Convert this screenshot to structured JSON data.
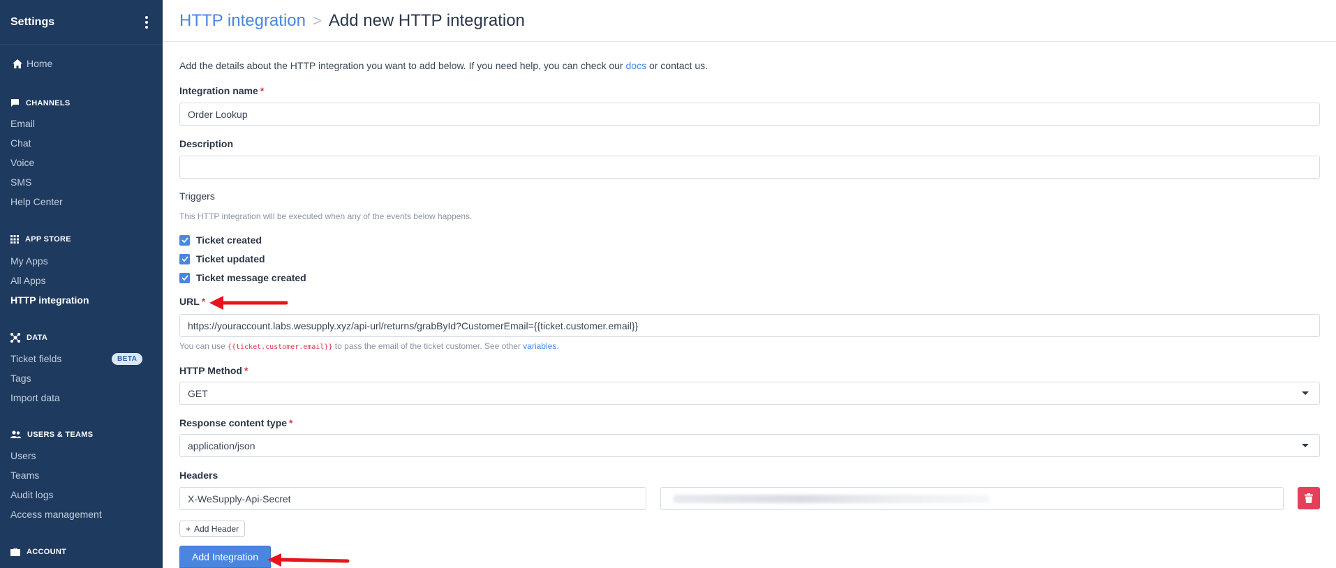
{
  "sidebar": {
    "title": "Settings",
    "home": "Home",
    "sections": {
      "channels": "CHANNELS",
      "app_store": "APP STORE",
      "data": "DATA",
      "users_teams": "USERS & TEAMS",
      "account": "ACCOUNT"
    },
    "channels": [
      "Email",
      "Chat",
      "Voice",
      "SMS",
      "Help Center"
    ],
    "app_store": [
      "My Apps",
      "All Apps",
      "HTTP integration"
    ],
    "data": [
      "Ticket fields",
      "Tags",
      "Import data"
    ],
    "data_badge": "BETA",
    "users_teams": [
      "Users",
      "Teams",
      "Audit logs",
      "Access management"
    ]
  },
  "breadcrumb": {
    "parent": "HTTP integration",
    "separator": ">",
    "current": "Add new HTTP integration"
  },
  "intro": {
    "before": "Add the details about the HTTP integration you want to add below. If you need help, you can check our ",
    "link": "docs",
    "after": " or contact us."
  },
  "form": {
    "name_label": "Integration name",
    "name_value": "Order Lookup",
    "required_mark": "*",
    "description_label": "Description",
    "description_value": "",
    "triggers_label": "Triggers",
    "triggers_help": "This HTTP integration will be executed when any of the events below happens.",
    "triggers": [
      {
        "label": "Ticket created",
        "checked": true
      },
      {
        "label": "Ticket updated",
        "checked": true
      },
      {
        "label": "Ticket message created",
        "checked": true
      }
    ],
    "url_label": "URL",
    "url_value": "https://youraccount.labs.wesupply.xyz/api-url/returns/grabById?CustomerEmail={{ticket.customer.email}}",
    "url_help_before": "You can use ",
    "url_help_code": "{{ticket.customer.email}}",
    "url_help_middle": " to pass the email of the ticket customer. See other ",
    "url_help_link": "variables",
    "url_help_after": ".",
    "method_label": "HTTP Method",
    "method_value": "GET",
    "content_type_label": "Response content type",
    "content_type_value": "application/json",
    "headers_label": "Headers",
    "header_key": "X-WeSupply-Api-Secret",
    "add_header": "Add Header",
    "submit": "Add Integration"
  },
  "colors": {
    "sidebar_bg": "#1f3a5f",
    "accent": "#4a86e0",
    "danger": "#e5405a",
    "annotation_arrow": "#e8141b"
  }
}
